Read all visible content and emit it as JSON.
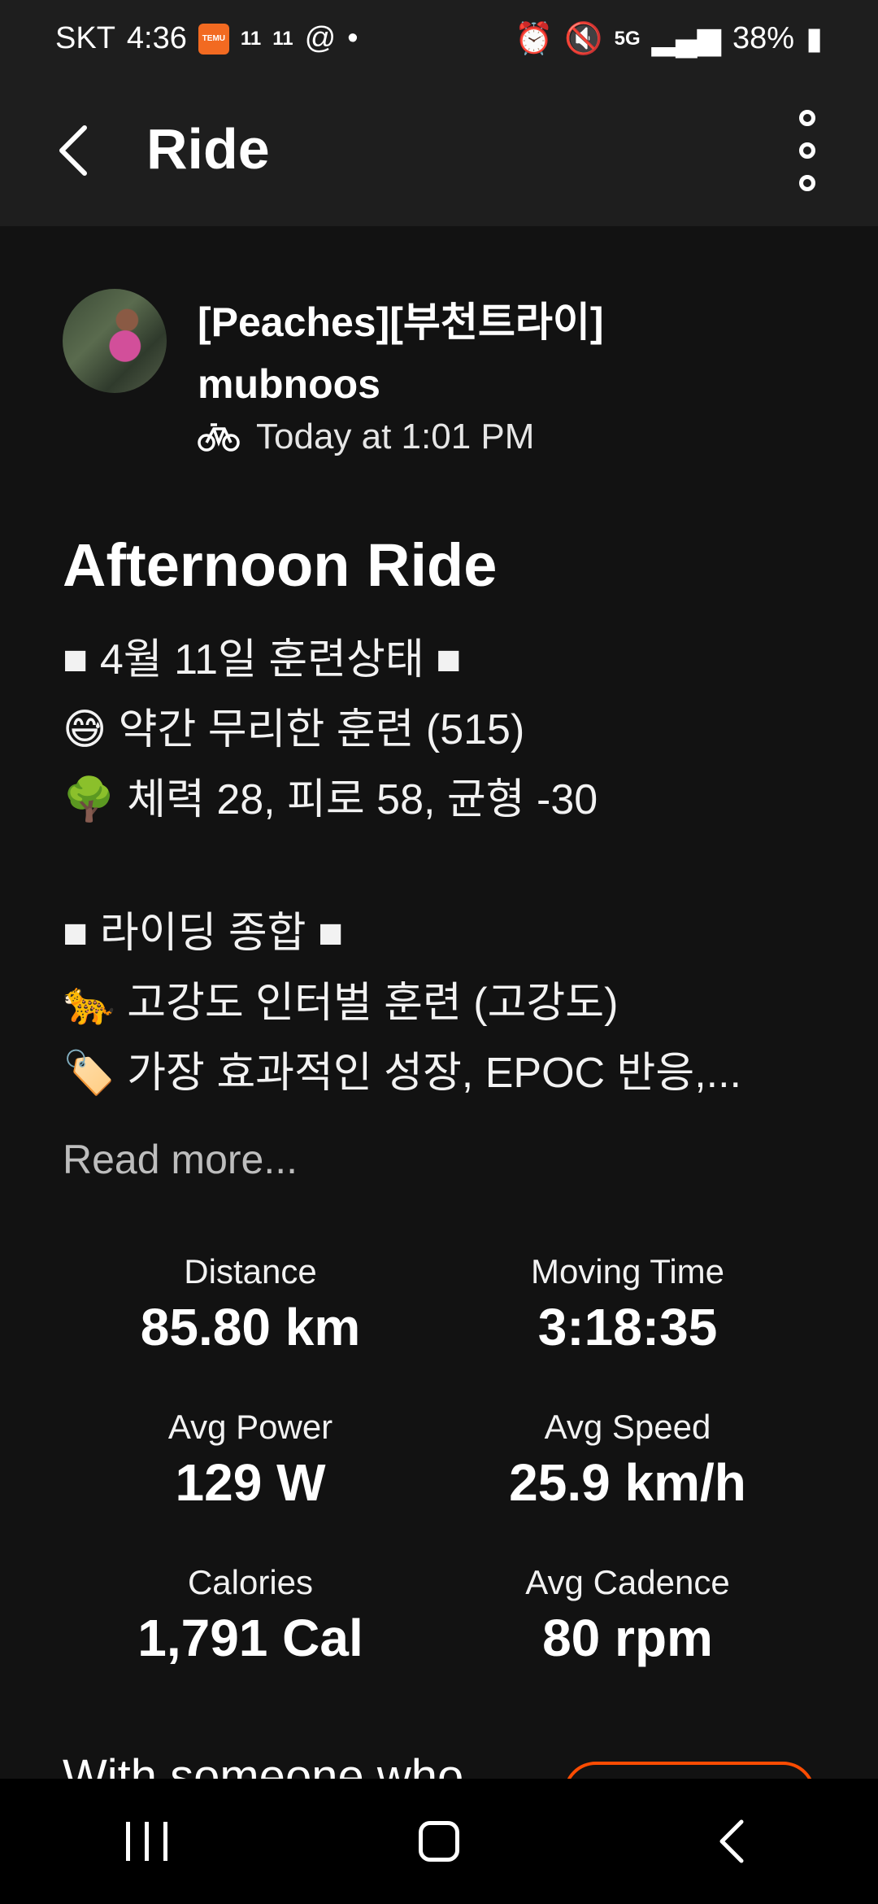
{
  "status_bar": {
    "carrier": "SKT",
    "time": "4:36",
    "temu_badge": "TEMU",
    "notif_1": "11",
    "notif_2": "11",
    "dot": "•",
    "network": "5G",
    "battery": "38%"
  },
  "app_bar": {
    "title": "Ride",
    "back_icon": "chevron-left-icon",
    "menu_icon": "more-vertical-icon"
  },
  "athlete": {
    "name_line1": "[Peaches][부천트라이]",
    "name_line2": "mubnoos",
    "timestamp": "Today at 1:01 PM",
    "activity_icon": "bike-icon"
  },
  "activity": {
    "title": "Afternoon Ride",
    "description": [
      "■ 4월 11일 훈련상태 ■",
      "😅 약간 무리한 훈련 (515)",
      "🌳 체력 28, 피로 58, 균형 -30",
      "",
      "■ 라이딩 종합 ■",
      "🐆 고강도 인터벌 훈련 (고강도)",
      "🏷️ 가장 효과적인 성장, EPOC 반응,..."
    ],
    "read_more": "Read more..."
  },
  "stats": [
    {
      "label": "Distance",
      "value": "85.80 km"
    },
    {
      "label": "Moving Time",
      "value": "3:18:35"
    },
    {
      "label": "Avg Power",
      "value": "129 W"
    },
    {
      "label": "Avg Speed",
      "value": "25.9 km/h"
    },
    {
      "label": "Calories",
      "value": "1,791 Cal"
    },
    {
      "label": "Avg Cadence",
      "value": "80 rpm"
    }
  ],
  "follow": {
    "text": "With someone who"
  },
  "colors": {
    "background": "#121212",
    "app_bar": "#1e1e1e",
    "accent": "#fc4c02"
  }
}
